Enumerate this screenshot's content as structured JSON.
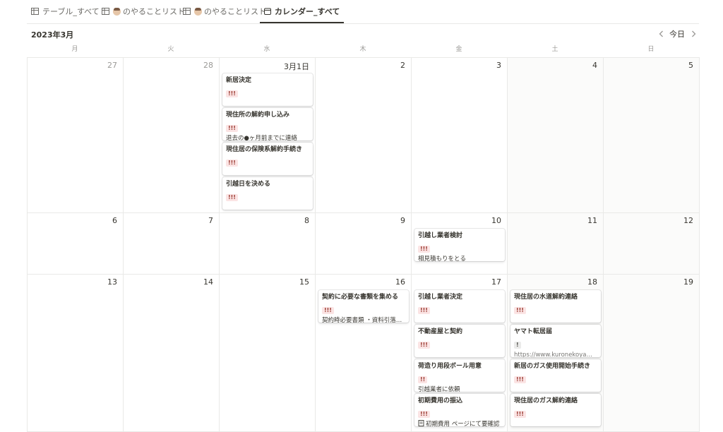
{
  "tabs": [
    {
      "label": "テーブル_すべて",
      "icon": "table-icon",
      "active": false
    },
    {
      "label": "のやることリスト",
      "icon": "table-icon",
      "active": false
    },
    {
      "label": "のやることリスト",
      "icon": "table-icon",
      "active": false
    },
    {
      "label": "カレンダー_すべて",
      "icon": "calendar-icon",
      "active": true
    }
  ],
  "calendar": {
    "month_label": "2023年3月",
    "today_label": "今日",
    "weekdays": [
      "月",
      "火",
      "水",
      "木",
      "金",
      "土",
      "日"
    ],
    "weeks": [
      [
        "27",
        "28",
        "3月1日",
        "2",
        "3",
        "4",
        "5"
      ],
      [
        "6",
        "7",
        "8",
        "9",
        "10",
        "11",
        "12"
      ],
      [
        "13",
        "14",
        "15",
        "16",
        "17",
        "18",
        "19"
      ]
    ]
  },
  "events": [
    {
      "title": "新居決定",
      "badge": "!!!",
      "badge_color": "red",
      "note": ""
    },
    {
      "title": "現住所の解約申し込み",
      "badge": "!!!",
      "badge_color": "red",
      "note": "退去の●ヶ月前までに連絡"
    },
    {
      "title": "現住居の保険系解約手続き",
      "badge": "!!!",
      "badge_color": "red",
      "note": ""
    },
    {
      "title": "引越日を決める",
      "badge": "!!!",
      "badge_color": "red",
      "note": ""
    },
    {
      "title": "引越し業者検討",
      "badge": "!!!",
      "badge_color": "red",
      "note": "相見積もりをとる"
    },
    {
      "title": "契約に必要な書類を集める",
      "badge": "!!!",
      "badge_color": "red",
      "note": "契約時必要書類 ・資料引落口..."
    },
    {
      "title": "引越し業者決定",
      "badge": "!!!",
      "badge_color": "red",
      "note": ""
    },
    {
      "title": "不動産屋と契約",
      "badge": "!!!",
      "badge_color": "red",
      "note": ""
    },
    {
      "title": "荷造り用段ボール用意",
      "badge": "!!",
      "badge_color": "red",
      "note": "引越業者に依頼"
    },
    {
      "title": "初期費用の振込",
      "badge": "!!!",
      "badge_color": "red",
      "note": "初期費用 ページにて要確認"
    },
    {
      "title": "現住居の水道解約連絡",
      "badge": "!!!",
      "badge_color": "red",
      "note": ""
    },
    {
      "title": "ヤマト転居届",
      "badge": "!",
      "badge_color": "gray",
      "note": "https://www.kuronekoyamat..."
    },
    {
      "title": "新居のガス使用開始手続き",
      "badge": "!!!",
      "badge_color": "red",
      "note": ""
    },
    {
      "title": "現住居のガス解約連絡",
      "badge": "!!!",
      "badge_color": "red",
      "note": ""
    }
  ],
  "colors": {
    "badge_red_bg": "#fbe4e4",
    "badge_red_text": "#9a3a31",
    "badge_gray_bg": "#ebebea",
    "weekend_bg": "#fbfbfa"
  }
}
